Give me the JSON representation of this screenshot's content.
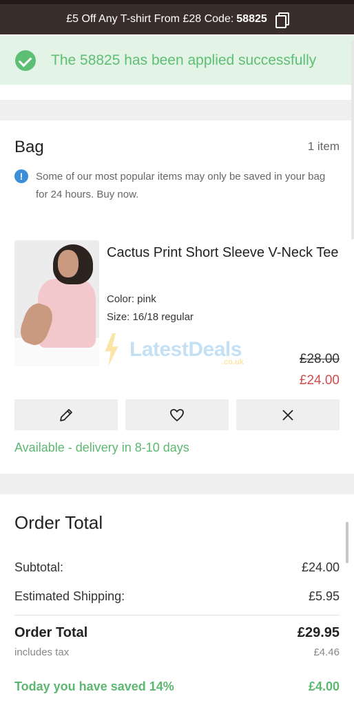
{
  "promo": {
    "text": "£5 Off Any T-shirt From £28 Code:",
    "code": "58825",
    "copy_icon": "copy-icon"
  },
  "banner": {
    "message": "The 58825 has been applied successfully",
    "icon": "check-circle-icon",
    "color": "#5cbf73"
  },
  "bag": {
    "title": "Bag",
    "count": "1 item",
    "info_icon": "info-icon",
    "notice": "Some of our most popular items may only be saved in your bag for 24 hours. Buy now."
  },
  "product": {
    "name": "Cactus Print Short Sleeve V-Neck Tee",
    "color": "Color: pink",
    "size": "Size: 16/18 regular",
    "price_original": "£28.00",
    "price_current": "£24.00",
    "actions": [
      "edit-pencil-icon",
      "heart-icon",
      "close-icon"
    ],
    "availability": "Available - delivery in 8-10 days"
  },
  "watermark": {
    "brand": "LatestDeals",
    "tld": ".co.uk"
  },
  "order": {
    "title": "Order Total",
    "subtotal_label": "Subtotal:",
    "subtotal_value": "£24.00",
    "shipping_label": "Estimated Shipping:",
    "shipping_value": "£5.95",
    "total_label": "Order Total",
    "total_value": "£29.95",
    "tax_label": "includes tax",
    "tax_value": "£4.46",
    "saved_label": "Today you have saved 14%",
    "saved_value": "£4.00"
  },
  "colors": {
    "accent_green": "#5cb870",
    "sale_red": "#d14b4b",
    "info_blue": "#3a8fd8",
    "promo_bg": "#3a2e2c"
  }
}
